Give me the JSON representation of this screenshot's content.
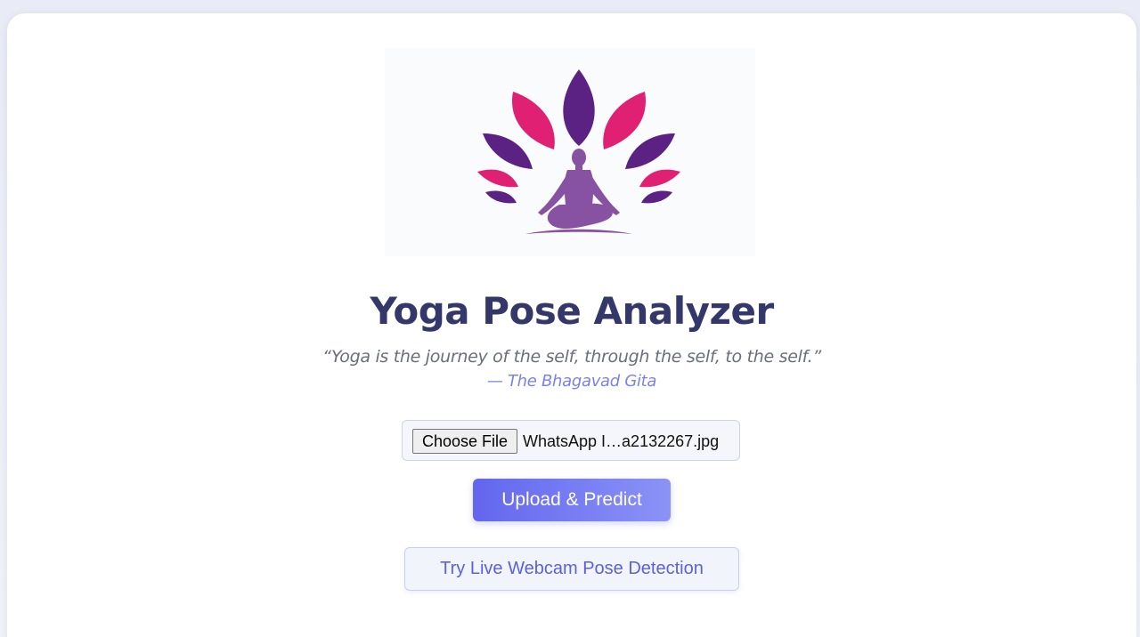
{
  "logo": {
    "icon": "lotus-meditation-icon",
    "colors": {
      "purple": "#5b2283",
      "pink": "#e02073",
      "figure": "#8752a2",
      "background": "#fafbfd"
    }
  },
  "header": {
    "title": "Yoga Pose Analyzer",
    "quote": "“Yoga is the journey of the self, through the self, to the self.”",
    "attribution": "— The Bhagavad Gita"
  },
  "upload_form": {
    "choose_file_label": "Choose File",
    "selected_file_name": "WhatsApp I…a2132267.jpg",
    "submit_label": "Upload & Predict"
  },
  "webcam": {
    "link_label": "Try Live Webcam Pose Detection"
  },
  "theme": {
    "title_color": "#33376a",
    "accent_start": "#6366ee",
    "accent_end": "#8b93f6",
    "attribution_color": "#7b83e6"
  }
}
